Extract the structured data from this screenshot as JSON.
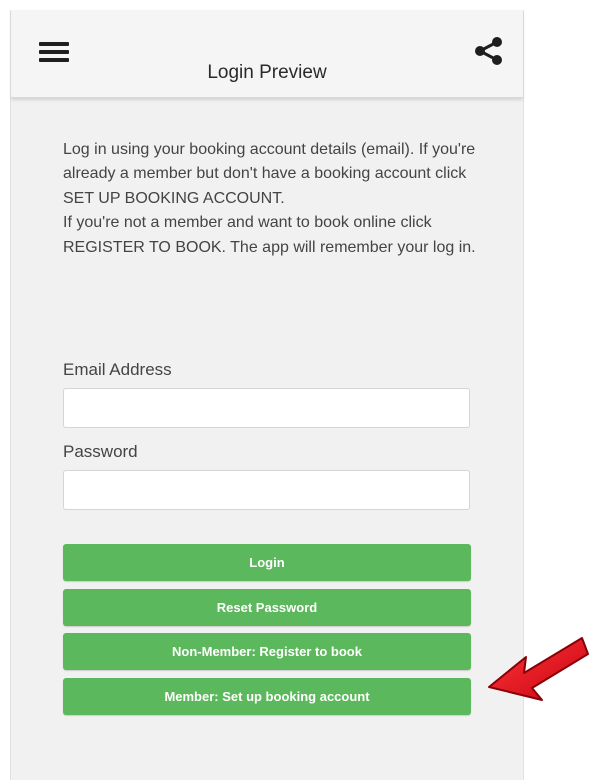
{
  "header": {
    "title": "Login Preview",
    "menu_icon": "hamburger-menu-icon",
    "share_icon": "share-icon"
  },
  "intro": {
    "line1": "Log in using your booking account details (email). If you're already a member but don't have a booking account click SET UP BOOKING ACCOUNT.",
    "line2": "If you're not a member and want to book online click REGISTER TO BOOK. The app will remember your log in."
  },
  "form": {
    "email_label": "Email Address",
    "email_value": "",
    "password_label": "Password",
    "password_value": ""
  },
  "buttons": {
    "login": "Login",
    "reset_password": "Reset Password",
    "register": "Non-Member: Register to book",
    "setup_account": "Member: Set up booking account"
  },
  "annotation": {
    "arrow_icon": "red-arrow-icon",
    "arrow_color": "#e8101a"
  },
  "colors": {
    "button_green": "#5cb85c",
    "background": "#f1f1f1"
  }
}
